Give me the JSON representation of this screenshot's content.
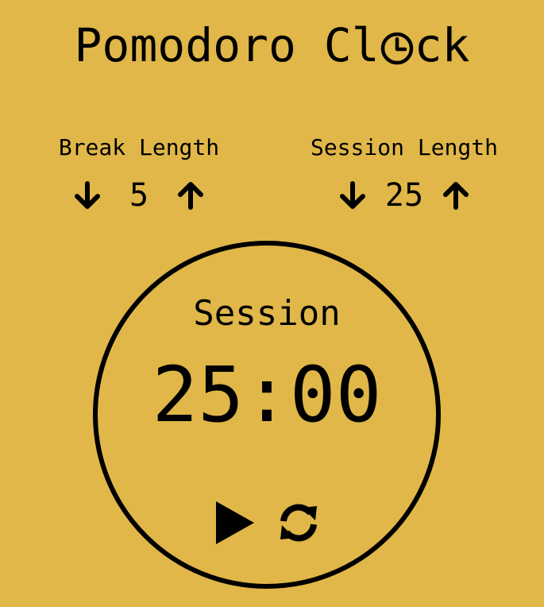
{
  "app": {
    "title_prefix": "Pomodoro Cl",
    "title_suffix": "ck"
  },
  "break": {
    "label": "Break Length",
    "value": "5",
    "decrement_icon": "arrow-down-icon",
    "increment_icon": "arrow-up-icon"
  },
  "session": {
    "label": "Session Length",
    "value": "25",
    "decrement_icon": "arrow-down-icon",
    "increment_icon": "arrow-up-icon"
  },
  "timer": {
    "label": "Session",
    "time_left": "25:00",
    "start_icon": "play-icon",
    "reset_icon": "refresh-icon"
  },
  "colors": {
    "background": "#e0b748",
    "foreground": "#000000"
  }
}
